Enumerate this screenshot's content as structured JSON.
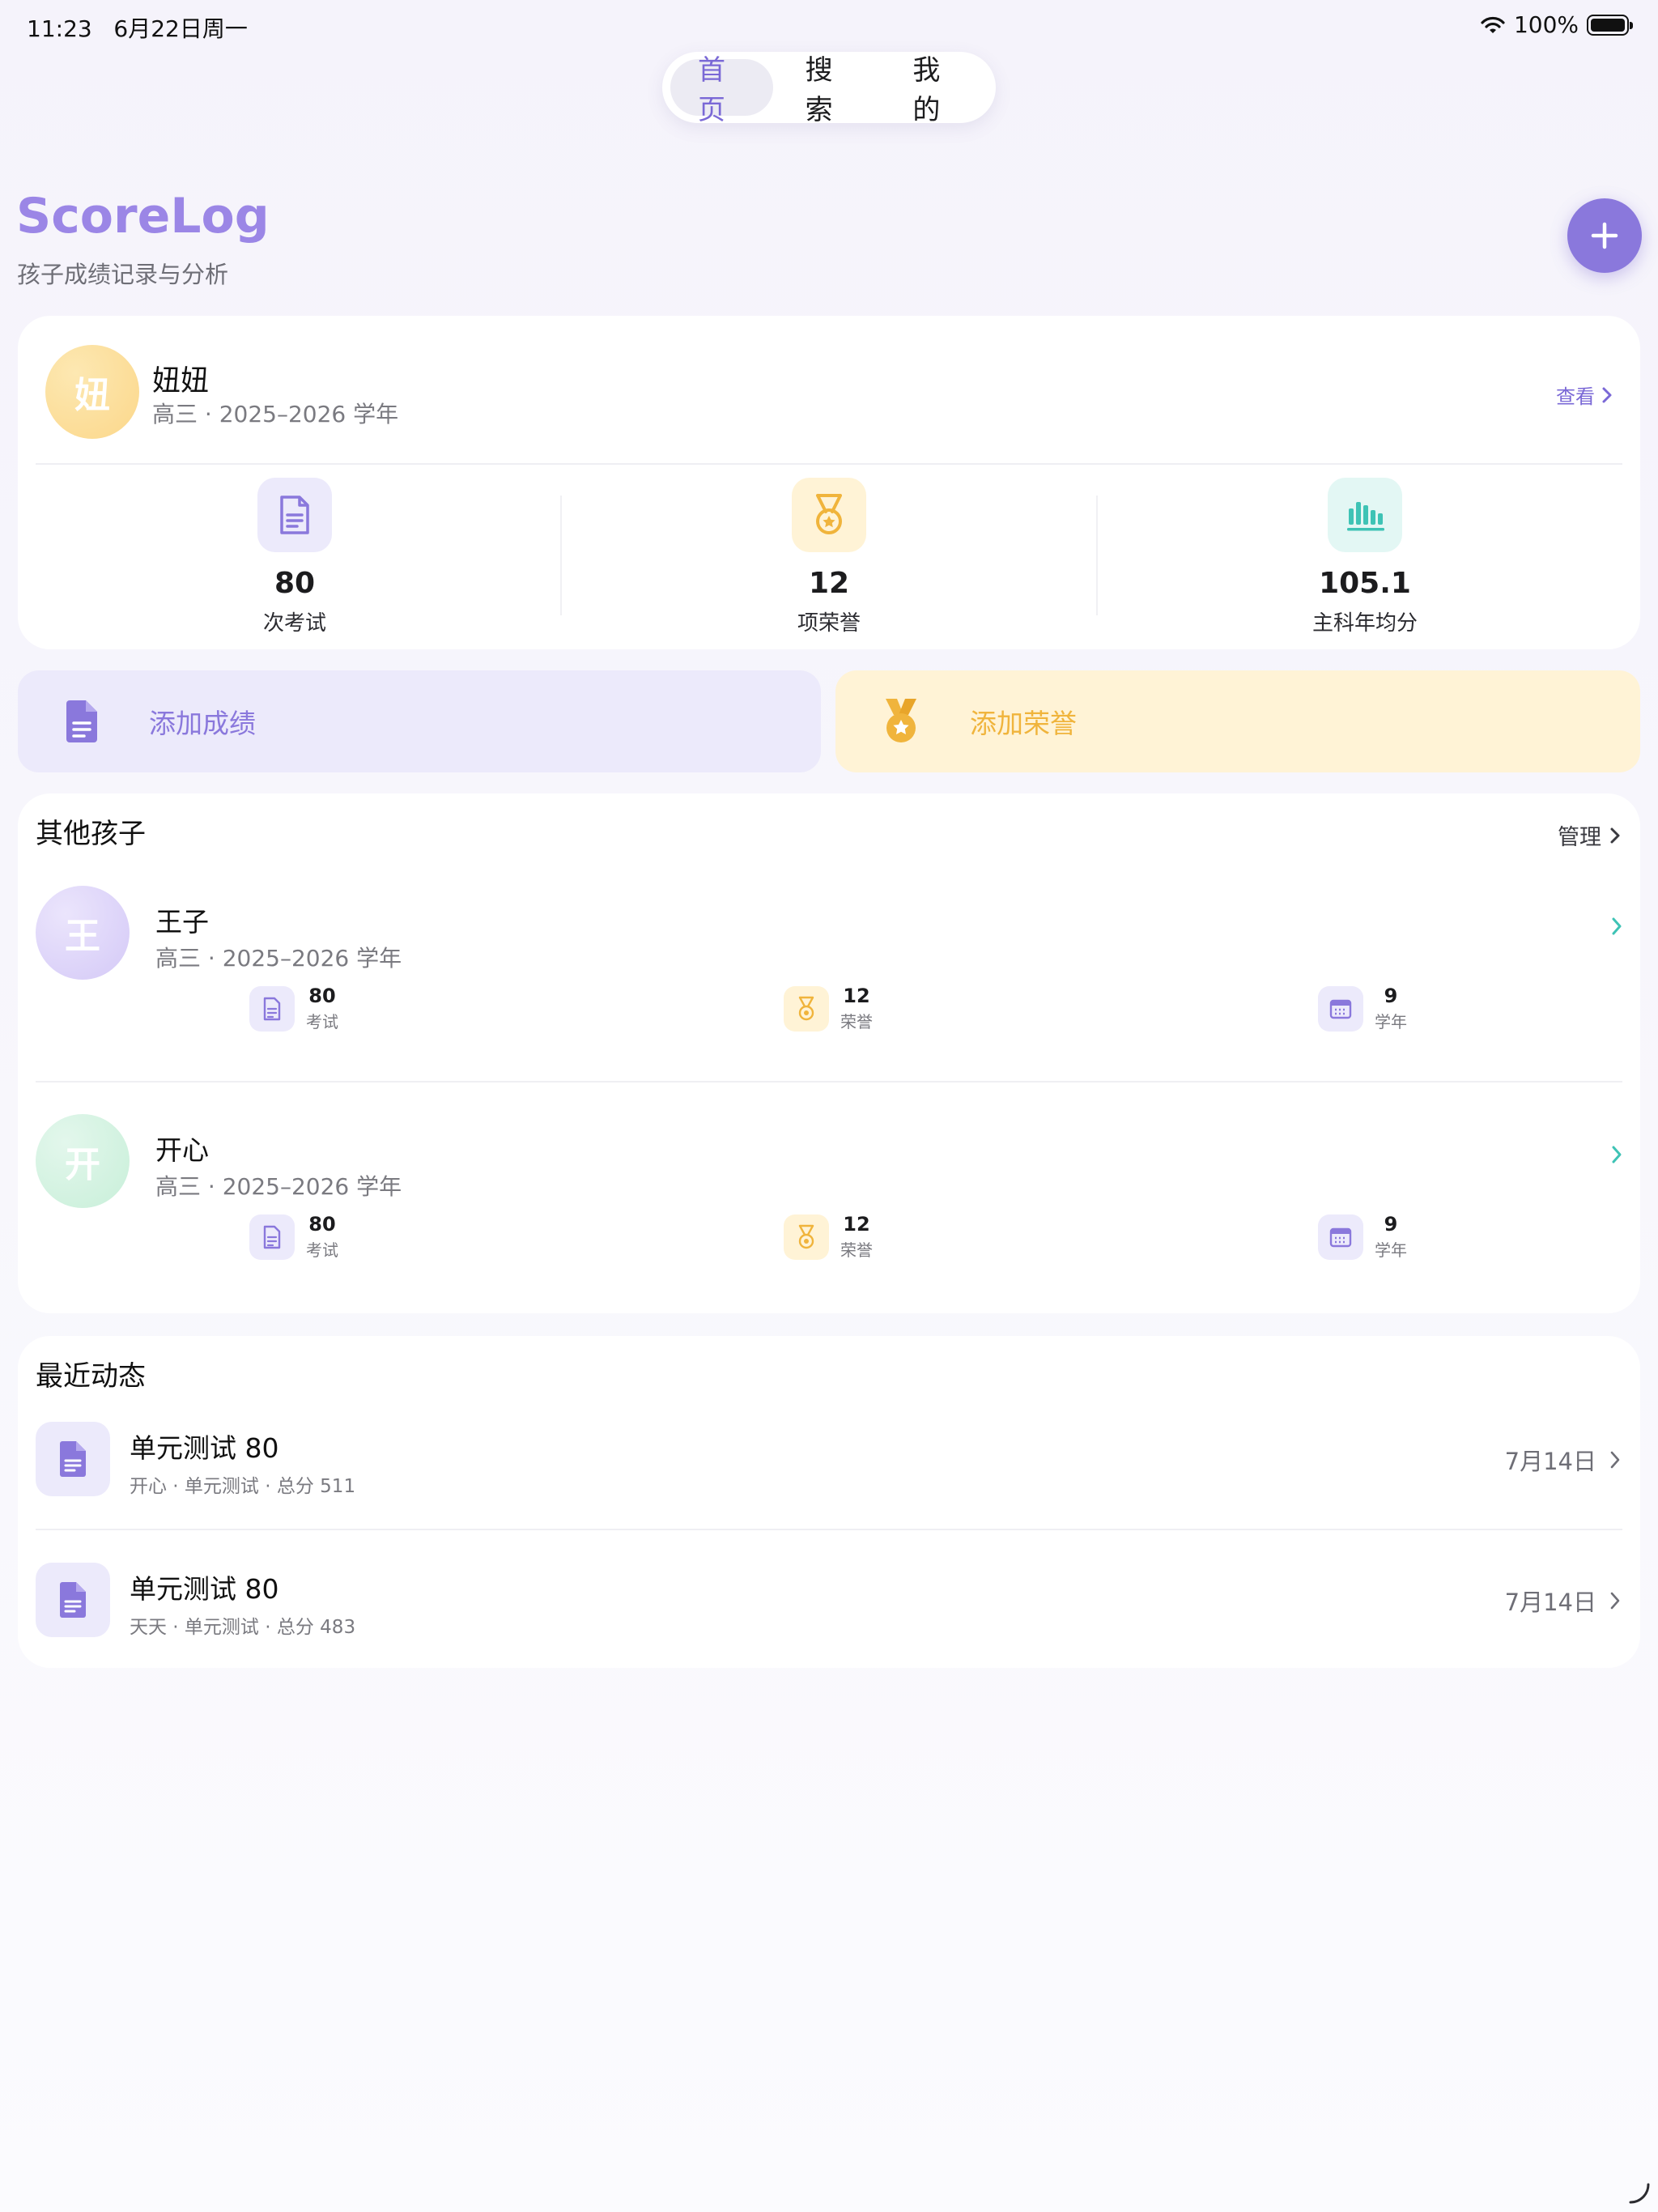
{
  "status_bar": {
    "time": "11:23",
    "date": "6月22日周一",
    "battery": "100%"
  },
  "tabs": [
    {
      "label": "首页",
      "active": true
    },
    {
      "label": "搜索",
      "active": false
    },
    {
      "label": "我的",
      "active": false
    }
  ],
  "header": {
    "title": "ScoreLog",
    "subtitle": "孩子成绩记录与分析"
  },
  "current_child": {
    "avatar_char": "妞",
    "name": "妞妞",
    "meta": "高三 · 2025–2026 学年",
    "view_label": "查看",
    "stats": [
      {
        "value": "80",
        "label": "次考试",
        "icon": "document-icon"
      },
      {
        "value": "12",
        "label": "项荣誉",
        "icon": "medal-icon"
      },
      {
        "value": "105.1",
        "label": "主科年均分",
        "icon": "bar-chart-icon"
      }
    ]
  },
  "actions": {
    "add_score": "添加成绩",
    "add_honor": "添加荣誉"
  },
  "other_children": {
    "title": "其他孩子",
    "manage_label": "管理",
    "items": [
      {
        "avatar_char": "王",
        "name": "王子",
        "meta": "高三 · 2025–2026 学年",
        "stats": [
          {
            "value": "80",
            "label": "考试"
          },
          {
            "value": "12",
            "label": "荣誉"
          },
          {
            "value": "9",
            "label": "学年"
          }
        ]
      },
      {
        "avatar_char": "开",
        "name": "开心",
        "meta": "高三 · 2025–2026 学年",
        "stats": [
          {
            "value": "80",
            "label": "考试"
          },
          {
            "value": "12",
            "label": "荣誉"
          },
          {
            "value": "9",
            "label": "学年"
          }
        ]
      }
    ]
  },
  "recent": {
    "title": "最近动态",
    "items": [
      {
        "title": "单元测试 80",
        "meta": "开心 · 单元测试 · 总分 511",
        "date": "7月14日"
      },
      {
        "title": "单元测试 80",
        "meta": "天天 · 单元测试 · 总分 483",
        "date": "7月14日"
      }
    ]
  },
  "colors": {
    "accent": "#8a78dc",
    "title": "#9b86e6",
    "honor": "#f0b43c",
    "teal": "#3ec3b5"
  }
}
